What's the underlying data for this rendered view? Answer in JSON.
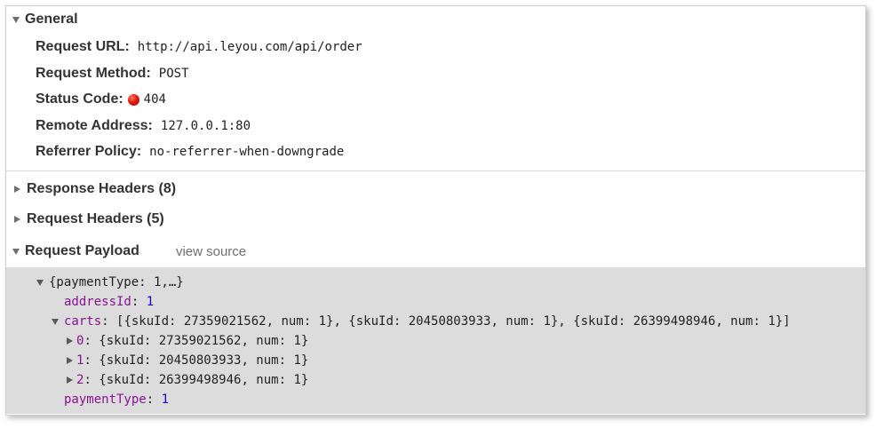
{
  "general": {
    "title": "General",
    "rows": [
      {
        "label": "Request URL:",
        "value": "http://api.leyou.com/api/order"
      },
      {
        "label": "Request Method:",
        "value": "POST"
      },
      {
        "label": "Status Code:",
        "value": "404"
      },
      {
        "label": "Remote Address:",
        "value": "127.0.0.1:80"
      },
      {
        "label": "Referrer Policy:",
        "value": "no-referrer-when-downgrade"
      }
    ]
  },
  "response_headers": {
    "title": "Response Headers (8)"
  },
  "request_headers": {
    "title": "Request Headers (5)"
  },
  "payload": {
    "title": "Request Payload",
    "view_source": "view source",
    "root": "{paymentType: 1,…}",
    "address_key": "addressId",
    "address_val": "1",
    "carts_key": "carts",
    "carts_summary": "[{skuId: 27359021562, num: 1}, {skuId: 20450803933, num: 1}, {skuId: 26399498946, num: 1}]",
    "items": [
      {
        "index": "0",
        "value": "{skuId: 27359021562, num: 1}"
      },
      {
        "index": "1",
        "value": "{skuId: 20450803933, num: 1}"
      },
      {
        "index": "2",
        "value": "{skuId: 26399498946, num: 1}"
      }
    ],
    "payment_key": "paymentType",
    "payment_val": "1"
  },
  "colors": {
    "status_dot": "#e21b0c",
    "key": "#881391",
    "number": "#1c00cf",
    "payload_bg": "#dcdcdc"
  },
  "icons": [
    "expand-triangle-down-icon",
    "collapse-triangle-right-icon",
    "status-error-dot-icon"
  ]
}
